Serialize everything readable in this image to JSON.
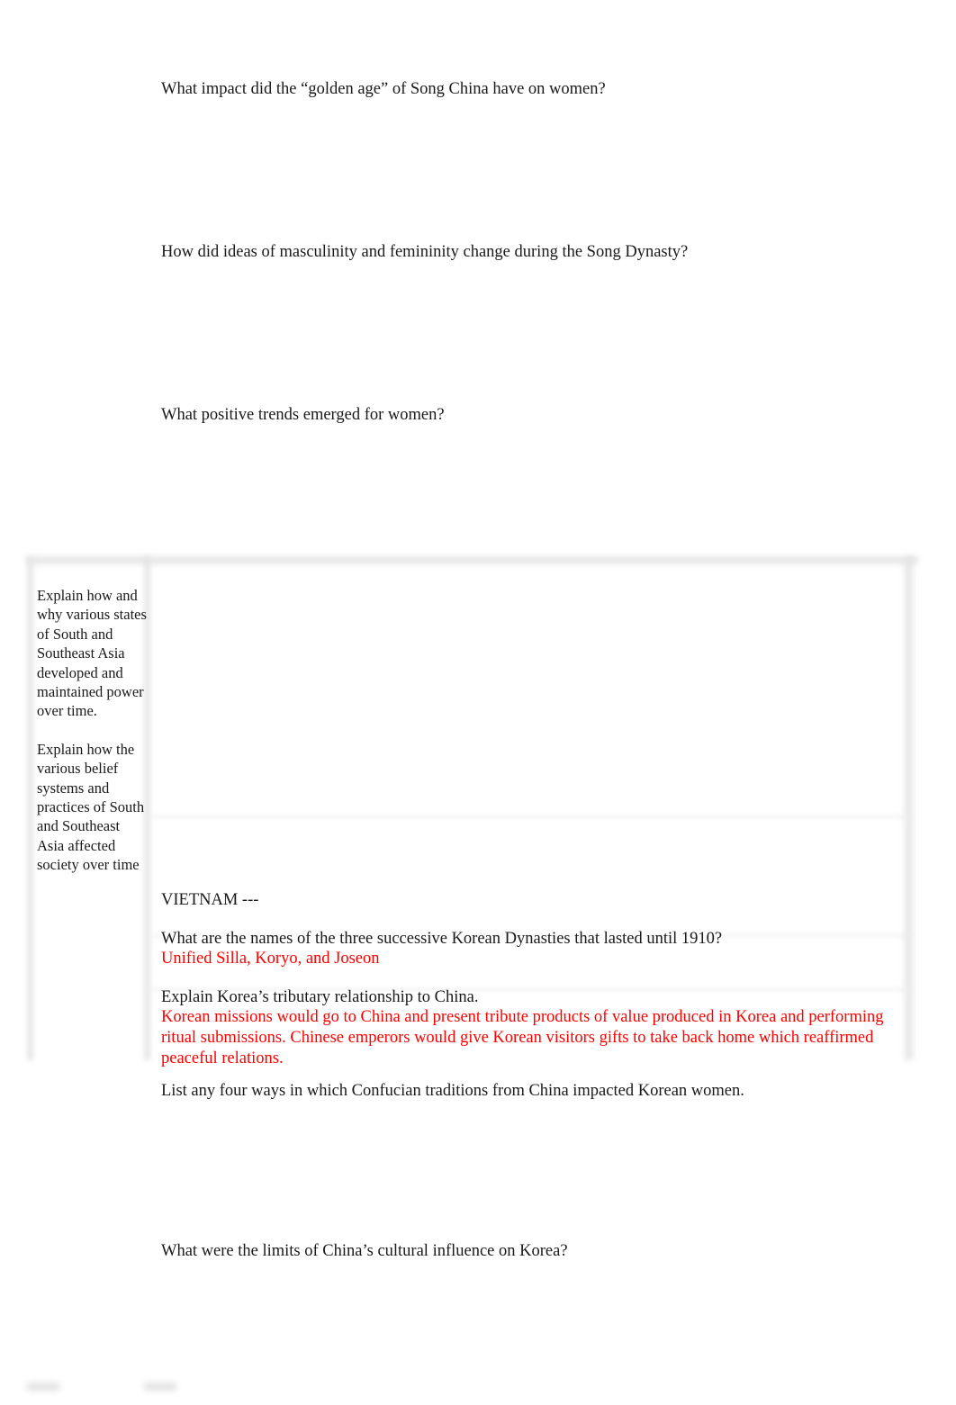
{
  "document": {
    "type": "study-guide-worksheet",
    "text_color": "#1a1a1a",
    "answer_color": "#ff0000",
    "background": "#ffffff"
  },
  "top_questions": {
    "q1": "What impact did the “golden age” of Song China have on women?",
    "q2": "How did ideas of masculinity and femininity change during the Song Dynasty?",
    "q3": "What positive trends emerged for women?"
  },
  "objectives_table": {
    "left_column": {
      "objective_1": "Explain how and why various states of South and Southeast Asia developed and maintained power over time.",
      "objective_2": "Explain how the various belief systems and practices of South and Southeast Asia affected society over time"
    },
    "right_column": {
      "section_header": "VIETNAM ---",
      "q_dynasties": "What are the names of the three successive Korean Dynasties that lasted until 1910?",
      "a_dynasties": "Unified Silla, Koryo, and Joseon",
      "q_tributary": "Explain Korea’s tributary relationship to China.",
      "a_tributary": "Korean missions would go to China and present tribute products of value produced in Korea and performing ritual submissions. Chinese emperors would give Korean visitors gifts to take back home which reaffirmed peaceful relations."
    }
  },
  "below_questions": {
    "q4": "List any four ways in which Confucian traditions from China impacted Korean women.",
    "q5": "What were the limits of China’s cultural influence on Korea?"
  }
}
